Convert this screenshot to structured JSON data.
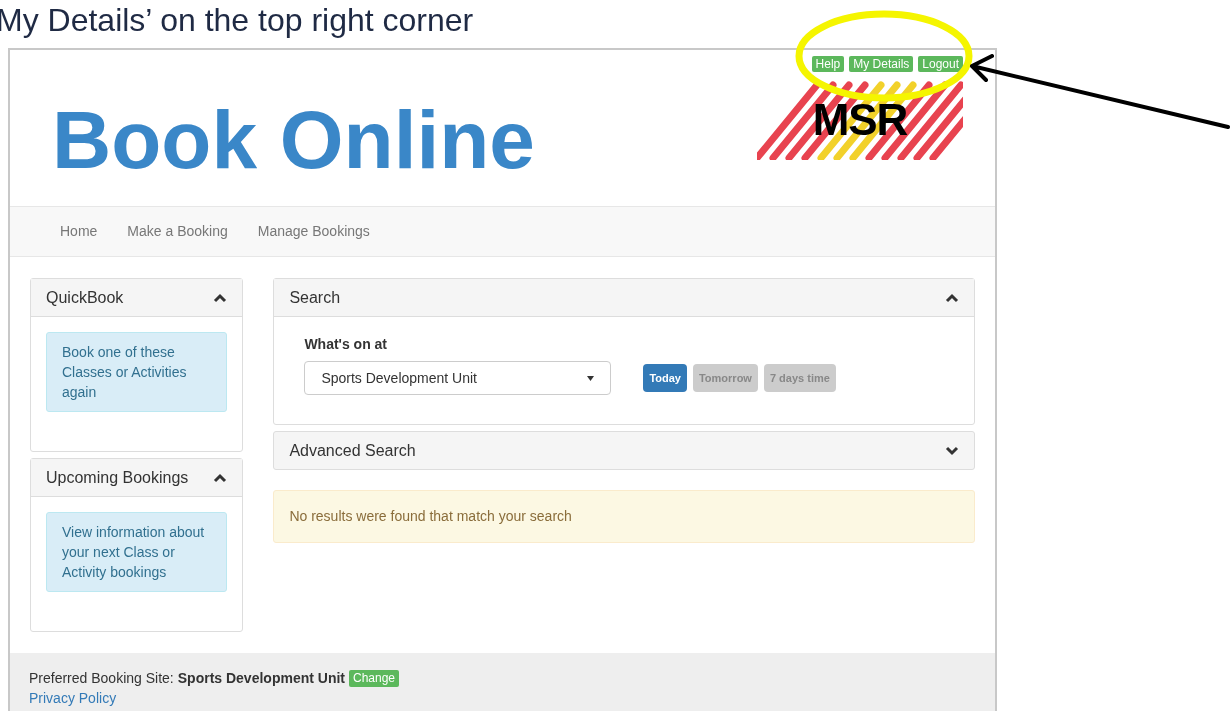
{
  "caption": "My Details’ on the top right corner",
  "header_links": [
    {
      "label": "Help"
    },
    {
      "label": "My Details"
    },
    {
      "label": "Logout"
    }
  ],
  "title": "Book Online",
  "logo_text": "MSR",
  "nav": [
    {
      "label": "Home"
    },
    {
      "label": "Make a Booking"
    },
    {
      "label": "Manage Bookings"
    }
  ],
  "sidebar": [
    {
      "title": "QuickBook",
      "expanded": true,
      "info": "Book one of these Classes or Activities again"
    },
    {
      "title": "Upcoming Bookings",
      "expanded": true,
      "info": "View information about your next Class or Activity bookings"
    }
  ],
  "search": {
    "title": "Search",
    "expanded": true,
    "label": "What's on at",
    "select_value": "Sports Development Unit",
    "periods": [
      {
        "label": "Today",
        "selected": true
      },
      {
        "label": "Tomorrow",
        "selected": false
      },
      {
        "label": "7 days time",
        "selected": false
      }
    ]
  },
  "advanced_search": {
    "title": "Advanced Search",
    "expanded": false
  },
  "alert": "No results were found that match your search",
  "footer": {
    "site_label": "Preferred Booking Site:",
    "site": "Sports Development Unit",
    "change": "Change",
    "privacy": "Privacy Policy"
  }
}
